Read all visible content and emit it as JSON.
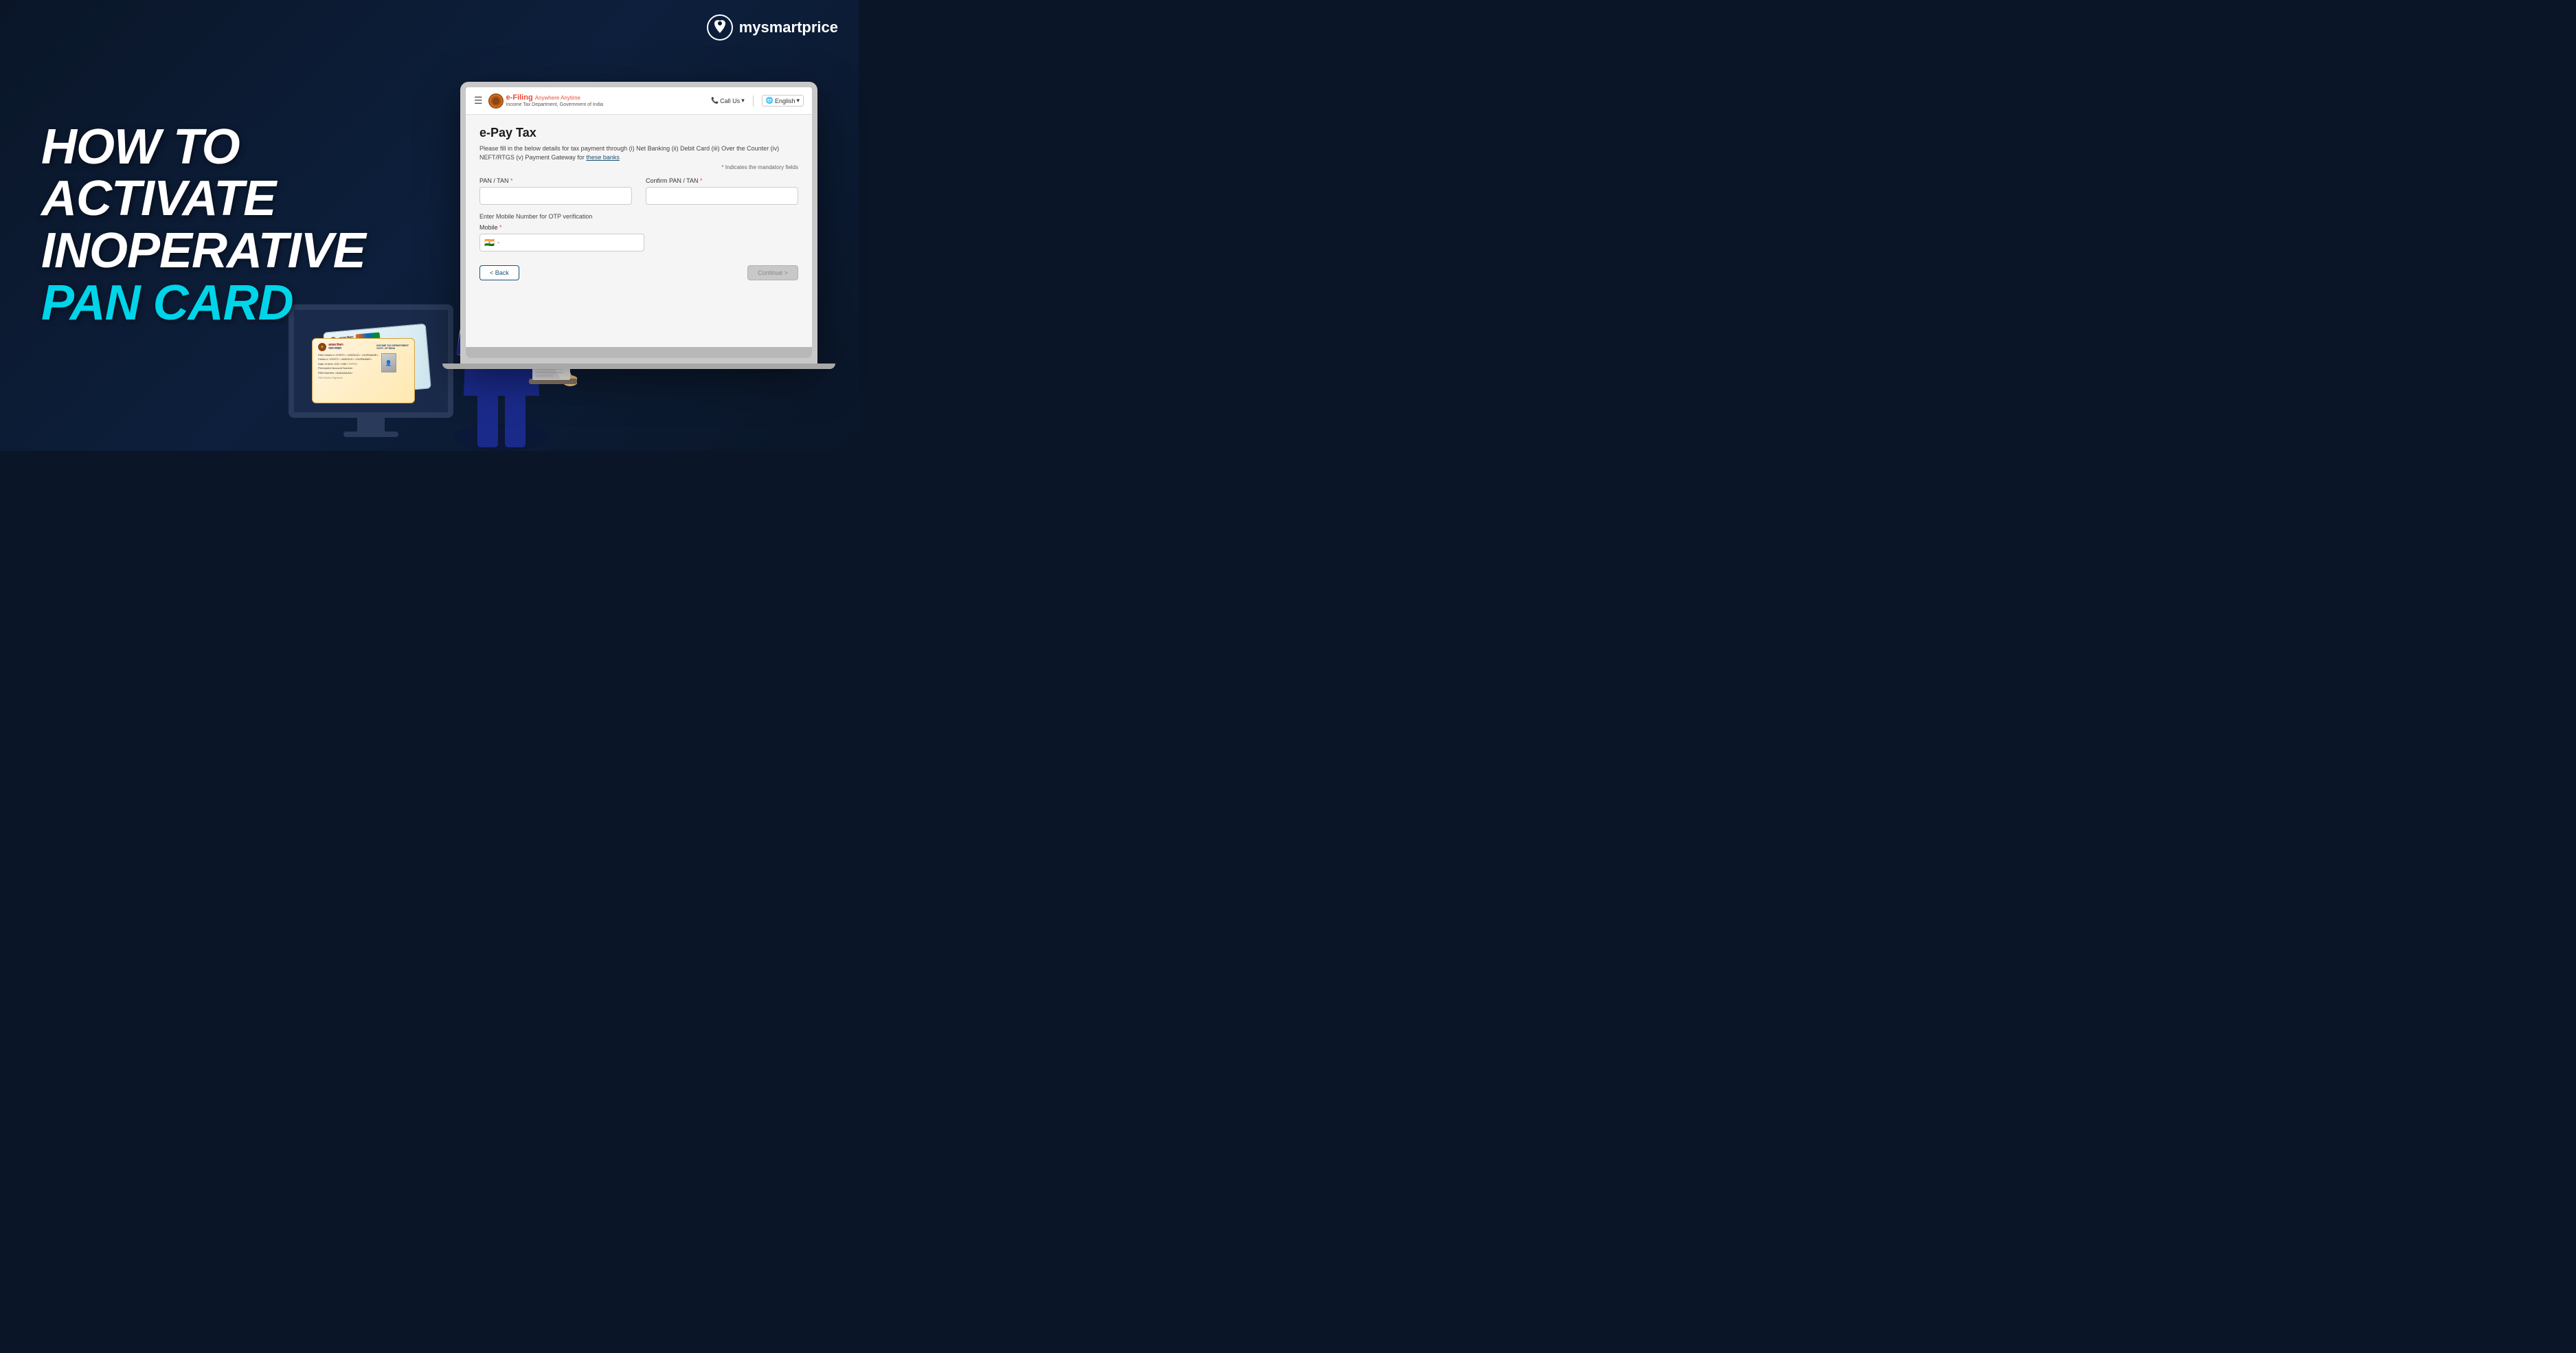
{
  "brand": {
    "name": "mysmartprice",
    "logo_icon": "M"
  },
  "headline": {
    "line1": "HOW TO ACTIVATE",
    "line2_normal": "INOPERATIVE ",
    "line2_cyan": "PAN CARD"
  },
  "efiling": {
    "site_name": "e-Filing",
    "site_tagline": "Anywhere Anytime",
    "site_subtitle": "Income Tax Department, Government of India",
    "call_us": "Call Us",
    "language": "English",
    "page_title": "e-Pay Tax",
    "description": "Please fill in the below details for tax payment through (i) Net Banking (ii) Debit Card (iii) Over the Counter (iv) NEFT/RTGS (v) Payment Gateway for",
    "these_banks": "these banks",
    "mandatory_note": "* Indicates the mandatory fields",
    "fields": {
      "pan_tan_label": "PAN / TAN",
      "confirm_pan_tan_label": "Confirm PAN / TAN",
      "otp_note": "Enter Mobile Number for OTP verification",
      "mobile_label": "Mobile",
      "required_mark": "*"
    },
    "buttons": {
      "back": "< Back",
      "continue": "Continue >"
    },
    "flag": "🇮🇳",
    "mobile_prefix": "-"
  },
  "pan_card": {
    "front_text": "आयकर विभाग | भारत सरकार",
    "dept": "INCOME TAX DEPARTMENT",
    "govt": "GOVT. OF INDIA",
    "fields_line1": "PAN Holder's <FIRST> <MIDDLE> <SURNAME>",
    "fields_line2": "Father's <FIRST> <MIDDLE> <SURNAME>",
    "fields_line3": "Date of birth <DD / MM / YYYY>",
    "fields_line4": "Permanent Account Number",
    "fields_line5": "PAN Number <AAAAAAAA>"
  }
}
